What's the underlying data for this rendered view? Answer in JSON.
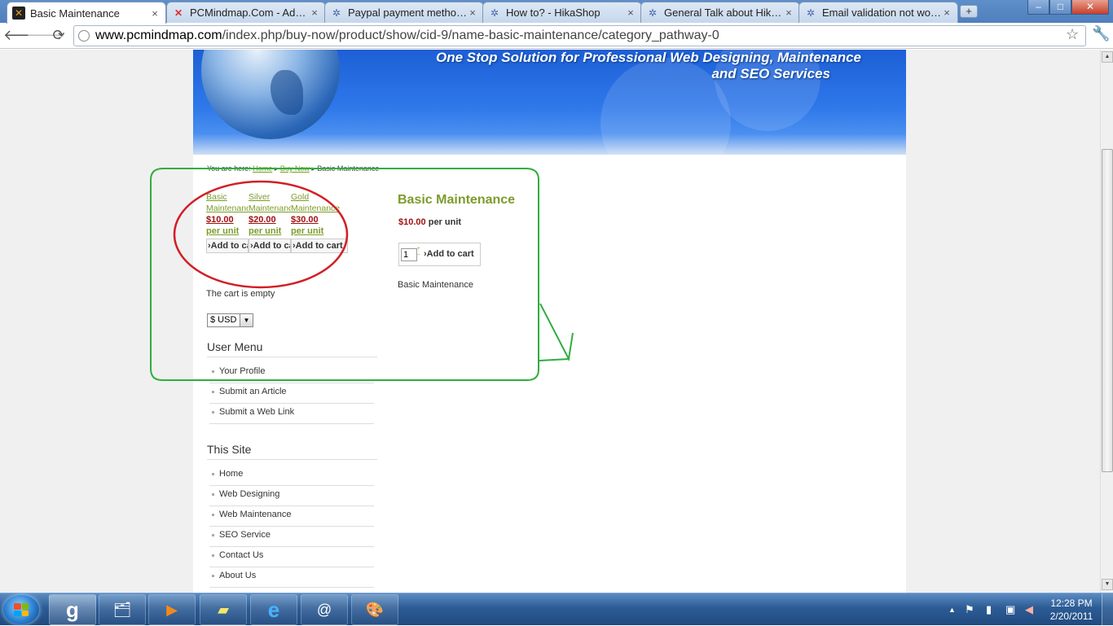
{
  "tabs": [
    {
      "title": "Basic Maintenance",
      "icon": "joomla-icon",
      "active": true
    },
    {
      "title": "PCMindmap.Com - Adm...",
      "icon": "joomla-icon"
    },
    {
      "title": "Paypal payment method ...",
      "icon": "hikashop-icon"
    },
    {
      "title": "How to? - HikaShop",
      "icon": "hikashop-icon"
    },
    {
      "title": "General Talk about HikaS...",
      "icon": "hikashop-icon"
    },
    {
      "title": "Email validation not work...",
      "icon": "hikashop-icon"
    }
  ],
  "tab_close": "×",
  "new_tab": "+",
  "window_buttons": {
    "minimize": "–",
    "maximize": "□",
    "close": "✕"
  },
  "toolbar": {
    "back": "🡐",
    "forward": "🡒",
    "reload": "⟳",
    "url_domain": "www.pcmindmap.com",
    "url_path": "/index.php/buy-now/product/show/cid-9/name-basic-maintenance/category_pathway-0",
    "star": "☆",
    "wrench": "🔧"
  },
  "banner": {
    "line1": "One Stop Solution for Professional Web Designing, Maintenance",
    "line2": "and SEO Services"
  },
  "breadcrumb": {
    "prefix": "You are here:",
    "home": "Home",
    "sep1": "▸",
    "buy_now": "Buy Now",
    "sep2": "▸",
    "current": "Basic Maintenance"
  },
  "products": [
    {
      "name1": "Basic",
      "name2": "Maintenance",
      "price": "$10.00",
      "unit": "per unit",
      "cart": "›Add to cart"
    },
    {
      "name1": "Silver",
      "name2": "Maintenance",
      "price": "$20.00",
      "unit": "per unit",
      "cart": "›Add to cart"
    },
    {
      "name1": "Gold",
      "name2": "Maintenance",
      "price": "$30.00",
      "unit": "per unit",
      "cart": "›Add to cart"
    }
  ],
  "cart_empty": "The cart is empty",
  "currency": {
    "selected": "$ USD",
    "arrow": "▼"
  },
  "user_menu": {
    "title": "User Menu",
    "items": [
      "Your Profile",
      "Submit an Article",
      "Submit a Web Link"
    ]
  },
  "this_site": {
    "title": "This Site",
    "items": [
      "Home",
      "Web Designing",
      "Web Maintenance",
      "SEO Service",
      "Contact Us",
      "About Us"
    ]
  },
  "product_detail": {
    "name": "Basic Maintenance",
    "price": "$10.00",
    "unit": "per unit",
    "quantity": "1",
    "add_to_cart": "›Add to cart",
    "description": "Basic Maintenance"
  },
  "annotation_colors": {
    "green": "#2fae3f",
    "red": "#d21f26"
  },
  "taskbar": {
    "apps": [
      {
        "icon": "google-icon",
        "glyph": "g"
      },
      {
        "icon": "explorer-icon",
        "glyph": "🗂"
      },
      {
        "icon": "media-player-icon",
        "glyph": "▶"
      },
      {
        "icon": "sticky-notes-icon",
        "glyph": "▰"
      },
      {
        "icon": "internet-explorer-icon",
        "glyph": "e"
      },
      {
        "icon": "email-icon",
        "glyph": "@"
      },
      {
        "icon": "paint-icon",
        "glyph": "🎨"
      }
    ],
    "tray_arrow": "▲",
    "time": "12:28 PM",
    "date": "2/20/2011"
  }
}
